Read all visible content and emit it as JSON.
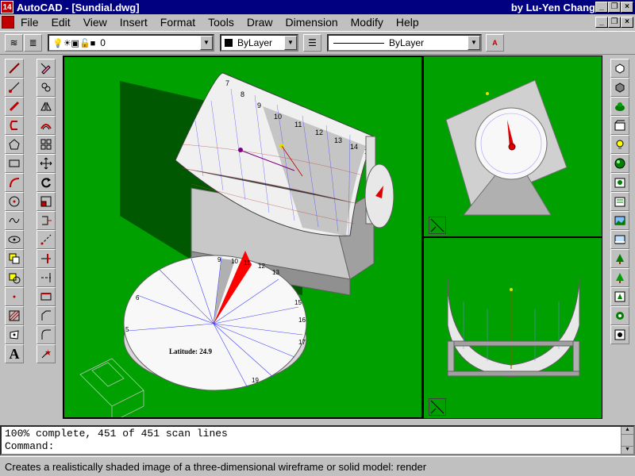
{
  "window": {
    "app_title": "AutoCAD - [Sundial.dwg]",
    "author": "by Lu-Yen Chang",
    "app_icon_label": "14"
  },
  "menu": [
    "File",
    "Edit",
    "View",
    "Insert",
    "Format",
    "Tools",
    "Draw",
    "Dimension",
    "Modify",
    "Help"
  ],
  "object_properties": {
    "layer_value": "0",
    "color_value": "ByLayer",
    "linetype_value": "ByLayer"
  },
  "command_area": {
    "history_line": "100% complete, 451 of 451 scan lines",
    "prompt": "Command:"
  },
  "status_bar": {
    "message": "Creates a realistically shaded image of a three-dimensional wireframe or solid model:  render"
  },
  "viewport": {
    "background_color": "#00a000",
    "dial_hours_cylinder": [
      "7",
      "8",
      "9",
      "10",
      "11",
      "12",
      "13",
      "14",
      "15"
    ],
    "dial_hours_flat": [
      "9",
      "10",
      "11",
      "12",
      "13",
      "15",
      "16",
      "17",
      "19",
      "5",
      "6"
    ],
    "latitude_label": "Latitude: 24.9"
  },
  "left_toolbar_icons": [
    "line-icon",
    "ray-icon",
    "polyline-icon",
    "arc-icon",
    "polygon-icon",
    "rectangle-icon",
    "spline-arc-icon",
    "circle-icon",
    "spline-icon",
    "ellipse-icon",
    "insert-block-icon",
    "make-block-icon",
    "point-icon",
    "hatch-icon",
    "region-icon",
    "text-icon"
  ],
  "modify_toolbar_icons": [
    "erase-icon",
    "copy-icon",
    "mirror-icon",
    "offset-icon",
    "array-icon",
    "move-icon",
    "rotate-icon",
    "scale-icon",
    "stretch-icon",
    "lengthen-icon",
    "trim-icon",
    "extend-icon",
    "break-icon",
    "chamfer-icon",
    "fillet-icon",
    "explode-icon"
  ],
  "right_toolbar_icons": [
    "hide-icon",
    "shade-icon",
    "render-icon",
    "scenes-icon",
    "lights-icon",
    "materials-icon",
    "materials-library-icon",
    "mapping-icon",
    "background-icon",
    "fog-icon",
    "landscape-new-icon",
    "landscape-edit-icon",
    "landscape-library-icon",
    "render-preferences-icon",
    "statistics-icon"
  ]
}
